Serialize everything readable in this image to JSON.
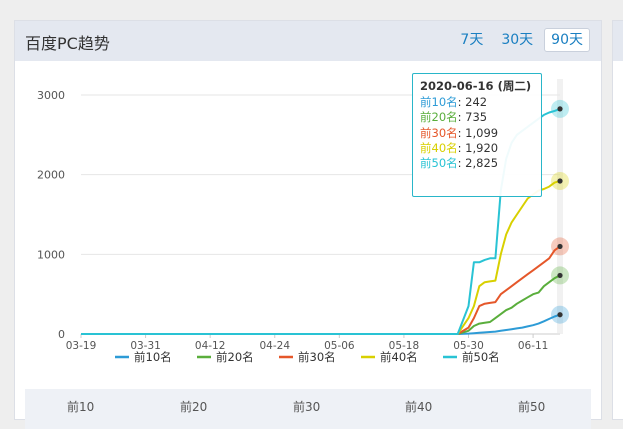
{
  "panel": {
    "title": "百度PC趋势"
  },
  "range_buttons": [
    {
      "label": "7天",
      "active": false
    },
    {
      "label": "30天",
      "active": false
    },
    {
      "label": "90天",
      "active": true
    }
  ],
  "tooltip": {
    "date": "2020-06-16 (周二)",
    "rows": [
      {
        "name": "前10名",
        "value": "242",
        "color": "#2d9bd6"
      },
      {
        "name": "前20名",
        "value": "735",
        "color": "#5aae3c"
      },
      {
        "name": "前30名",
        "value": "1,099",
        "color": "#e5572a"
      },
      {
        "name": "前40名",
        "value": "1,920",
        "color": "#d8d000"
      },
      {
        "name": "前50名",
        "value": "2,825",
        "color": "#29c3d4"
      }
    ]
  },
  "table_headers": [
    "前10",
    "前20",
    "前30",
    "前40",
    "前50"
  ],
  "chart_data": {
    "type": "line",
    "x_ticks": [
      "03-19",
      "03-31",
      "04-12",
      "04-24",
      "05-06",
      "05-18",
      "05-30",
      "06-11"
    ],
    "y_ticks": [
      0,
      1000,
      2000,
      3000
    ],
    "ylim": [
      0,
      3200
    ],
    "grid": true,
    "legend_position": "bottom",
    "x": [
      "03-19",
      "05-28",
      "05-30",
      "05-31",
      "06-01",
      "06-02",
      "06-03",
      "06-04",
      "06-05",
      "06-06",
      "06-07",
      "06-08",
      "06-09",
      "06-10",
      "06-11",
      "06-12",
      "06-13",
      "06-14",
      "06-15",
      "06-16"
    ],
    "series": [
      {
        "name": "前10名",
        "color": "#2d9bd6",
        "values": [
          0,
          0,
          5,
          10,
          15,
          20,
          25,
          30,
          40,
          50,
          60,
          70,
          80,
          95,
          110,
          130,
          160,
          190,
          220,
          242
        ]
      },
      {
        "name": "前20名",
        "color": "#5aae3c",
        "values": [
          0,
          0,
          40,
          100,
          130,
          140,
          150,
          200,
          250,
          300,
          330,
          380,
          420,
          460,
          500,
          520,
          600,
          650,
          700,
          735
        ]
      },
      {
        "name": "前30名",
        "color": "#e5572a",
        "values": [
          0,
          0,
          80,
          200,
          350,
          380,
          390,
          400,
          500,
          550,
          600,
          650,
          700,
          750,
          800,
          850,
          900,
          950,
          1050,
          1099
        ]
      },
      {
        "name": "前40名",
        "color": "#d8d000",
        "values": [
          0,
          0,
          200,
          350,
          600,
          650,
          660,
          670,
          1000,
          1250,
          1400,
          1500,
          1600,
          1700,
          1750,
          1800,
          1820,
          1850,
          1900,
          1920
        ]
      },
      {
        "name": "前50名",
        "color": "#29c3d4",
        "values": [
          0,
          0,
          350,
          900,
          900,
          930,
          950,
          950,
          1800,
          2200,
          2400,
          2500,
          2550,
          2600,
          2650,
          2700,
          2750,
          2780,
          2800,
          2825
        ]
      }
    ]
  }
}
